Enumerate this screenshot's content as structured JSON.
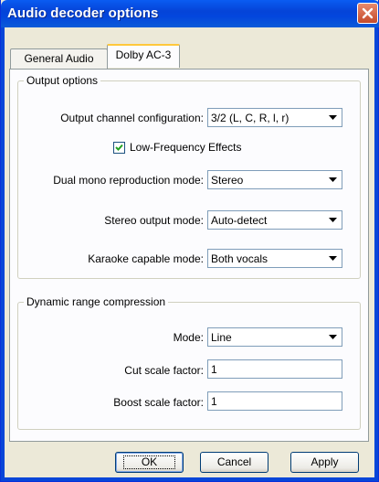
{
  "window": {
    "title": "Audio decoder options"
  },
  "tabs": [
    {
      "label": "General Audio"
    },
    {
      "label": "Dolby AC-3"
    }
  ],
  "output_options": {
    "legend": "Output options",
    "channel_config": {
      "label": "Output channel configuration:",
      "value": "3/2 (L, C, R, l, r)"
    },
    "lfe": {
      "label": "Low-Frequency Effects",
      "checked": true
    },
    "dual_mono": {
      "label": "Dual mono reproduction mode:",
      "value": "Stereo"
    },
    "stereo_output": {
      "label": "Stereo output mode:",
      "value": "Auto-detect"
    },
    "karaoke": {
      "label": "Karaoke capable mode:",
      "value": "Both vocals"
    }
  },
  "drc": {
    "legend": "Dynamic range compression",
    "mode": {
      "label": "Mode:",
      "value": "Line"
    },
    "cut": {
      "label": "Cut scale factor:",
      "value": "1"
    },
    "boost": {
      "label": "Boost scale factor:",
      "value": "1"
    }
  },
  "buttons": {
    "ok": "OK",
    "cancel": "Cancel",
    "apply": "Apply"
  },
  "icons": {
    "close": "close-icon",
    "dropdown": "chevron-down-icon",
    "check": "check-icon"
  }
}
